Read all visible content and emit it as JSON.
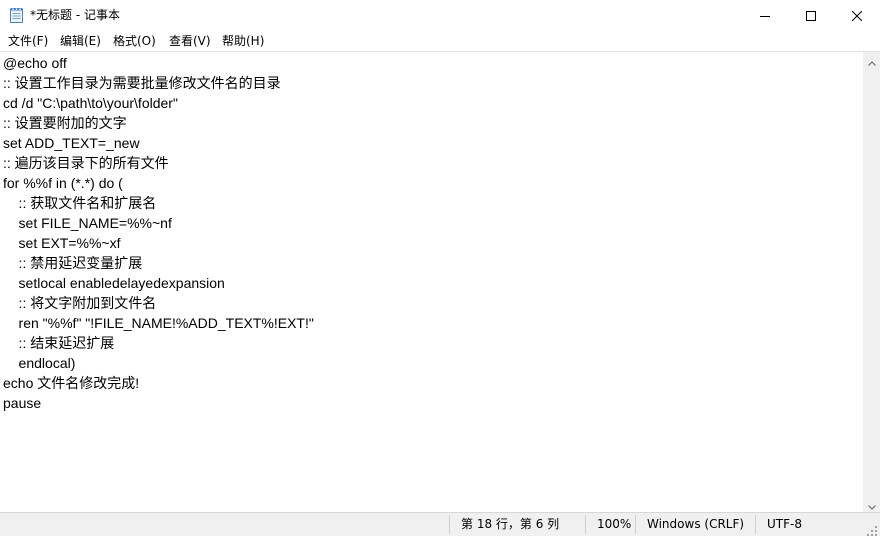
{
  "window": {
    "title": "*无标题 - 记事本"
  },
  "icons": {
    "app": "notepad-icon",
    "minimize": "minimize-icon",
    "maximize": "maximize-icon",
    "close": "close-icon"
  },
  "menu": {
    "items": [
      {
        "label": "文件(F)"
      },
      {
        "label": "编辑(E)"
      },
      {
        "label": "格式(O)"
      },
      {
        "label": "查看(V)"
      },
      {
        "label": "帮助(H)"
      }
    ]
  },
  "editor": {
    "lines": [
      "@echo off",
      ":: 设置工作目录为需要批量修改文件名的目录",
      "cd /d \"C:\\path\\to\\your\\folder\"",
      ":: 设置要附加的文字",
      "set ADD_TEXT=_new",
      ":: 遍历该目录下的所有文件",
      "for %%f in (*.*) do (",
      "    :: 获取文件名和扩展名",
      "    set FILE_NAME=%%~nf",
      "    set EXT=%%~xf",
      "    :: 禁用延迟变量扩展",
      "    setlocal enabledelayedexpansion",
      "    :: 将文字附加到文件名",
      "    ren \"%%f\" \"!FILE_NAME!%ADD_TEXT%!EXT!\"",
      "    :: 结束延迟扩展",
      "    endlocal)",
      "echo 文件名修改完成!",
      "pause"
    ]
  },
  "status": {
    "position": "第 18 行，第 6 列",
    "zoom": "100%",
    "line_ending": "Windows (CRLF)",
    "encoding": "UTF-8"
  },
  "colors": {
    "statusbar_bg": "#f0f0f0",
    "scrollbar_bg": "#f0f0f0"
  }
}
